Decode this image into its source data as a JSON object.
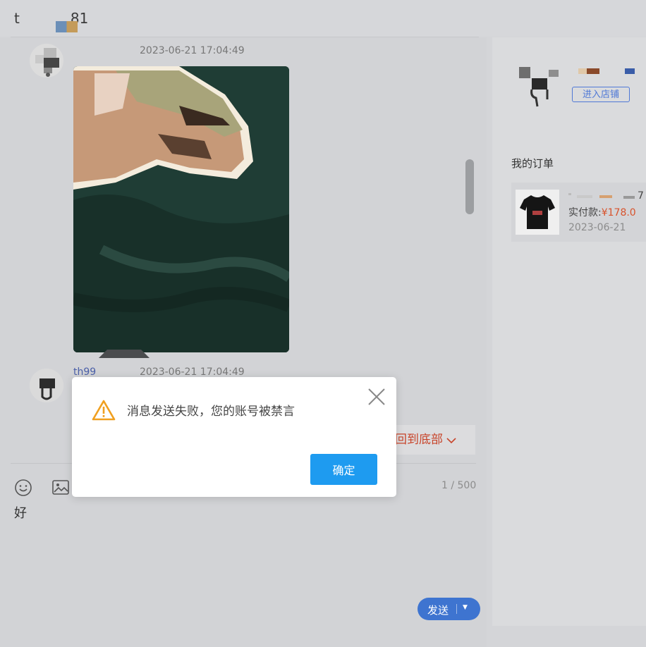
{
  "header": {
    "title_start": "t",
    "title_end": "81"
  },
  "chat": {
    "messages": [
      {
        "sender": "",
        "time": "2023-06-21 17:04:49"
      },
      {
        "sender": "th99",
        "time": "2023-06-21 17:04:49"
      }
    ],
    "back_to_bottom": "回到底部",
    "counter": "1 / 500",
    "input_value": "好",
    "send_label": "发送"
  },
  "sidebar": {
    "shop_button": "进入店铺",
    "orders_title": "我的订单",
    "order": {
      "name_suffix": "7",
      "paid_label": "实付款:",
      "price": "¥178.0",
      "date": "2023-06-21"
    }
  },
  "dialog": {
    "message": "消息发送失败，您的账号被禁言",
    "confirm_label": "确定"
  },
  "colors": {
    "send_button": "#3e74d0",
    "confirm_button": "#1e9bf0",
    "price": "#d8532c",
    "warning": "#f0a020"
  }
}
